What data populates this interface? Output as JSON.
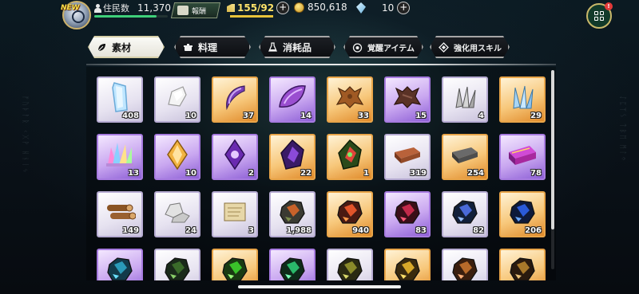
{
  "topbar": {
    "new_badge": "NEW",
    "residents_label": "住民数",
    "residents_value": "11,370",
    "residents_progress": 0.85,
    "report_label": "報酬",
    "stamina_value": "155/92",
    "stamina_progress": 1.0,
    "gold_value": "850,618",
    "crystal_value": "10",
    "menu_badge": "!"
  },
  "tabs": [
    {
      "label": "素材",
      "icon": "leaf-icon",
      "active": true
    },
    {
      "label": "料理",
      "icon": "pot-icon",
      "active": false
    },
    {
      "label": "消耗品",
      "icon": "flask-icon",
      "active": false
    },
    {
      "label": "覚醒アイテム",
      "icon": "awaken-orb-icon",
      "active": false
    },
    {
      "label": "強化用スキル",
      "icon": "skill-diamond-icon",
      "active": false
    }
  ],
  "colors": {
    "rarity_silver": "#e6e2f0",
    "rarity_purple": "#c9a7f0",
    "rarity_gold": "#f7c77a",
    "accent_green": "#3fd07a",
    "accent_yellow": "#ffe36a"
  },
  "items": [
    {
      "name": "crystal-shard-item",
      "rarity": "silver",
      "count": "408",
      "art": "crystal"
    },
    {
      "name": "white-stone-item",
      "rarity": "silver",
      "count": "10",
      "art": "whitestone"
    },
    {
      "name": "purple-claw-item",
      "rarity": "gold",
      "count": "37",
      "art": "claw"
    },
    {
      "name": "purple-scale-item",
      "rarity": "purple",
      "count": "14",
      "art": "scale"
    },
    {
      "name": "brown-hide-item",
      "rarity": "gold",
      "count": "33",
      "art": "hide"
    },
    {
      "name": "dark-hide-item",
      "rarity": "purple",
      "count": "15",
      "art": "darkhide"
    },
    {
      "name": "silver-feathers-item",
      "rarity": "silver",
      "count": "4",
      "art": "feathers"
    },
    {
      "name": "blue-feathers-item",
      "rarity": "gold",
      "count": "29",
      "art": "bluefeathers"
    },
    {
      "name": "rainbow-crystal-item",
      "rarity": "purple",
      "count": "13",
      "art": "rainbow"
    },
    {
      "name": "amber-gem-item",
      "rarity": "purple",
      "count": "10",
      "art": "ambergem"
    },
    {
      "name": "violet-gem-item",
      "rarity": "purple",
      "count": "2",
      "art": "violetgem"
    },
    {
      "name": "dark-core-item",
      "rarity": "gold",
      "count": "22",
      "art": "darkcore"
    },
    {
      "name": "green-core-item",
      "rarity": "gold",
      "count": "1",
      "art": "greencore"
    },
    {
      "name": "brick-item",
      "rarity": "silver",
      "count": "319",
      "art": "brick"
    },
    {
      "name": "iron-ingot-item",
      "rarity": "gold",
      "count": "254",
      "art": "ingot"
    },
    {
      "name": "pink-ingot-item",
      "rarity": "purple",
      "count": "78",
      "art": "pinkingot"
    },
    {
      "name": "logs-item",
      "rarity": "silver",
      "count": "149",
      "art": "logs"
    },
    {
      "name": "stone-blocks-item",
      "rarity": "silver",
      "count": "24",
      "art": "stones"
    },
    {
      "name": "parchment-item",
      "rarity": "silver",
      "count": "3",
      "art": "scroll"
    },
    {
      "name": "ore-rock-item",
      "rarity": "silver",
      "count": "1,988",
      "art": "ore1"
    },
    {
      "name": "red-ore-item",
      "rarity": "gold",
      "count": "940",
      "art": "ore2"
    },
    {
      "name": "crimson-ore-item",
      "rarity": "purple",
      "count": "83",
      "art": "ore3"
    },
    {
      "name": "blue-ore-item",
      "rarity": "silver",
      "count": "82",
      "art": "ore4"
    },
    {
      "name": "sapphire-ore-item",
      "rarity": "gold",
      "count": "206",
      "art": "ore5"
    },
    {
      "name": "blue-teal-ore-item",
      "rarity": "purple",
      "count": "",
      "art": "ore6"
    },
    {
      "name": "green-dark-ore-item",
      "rarity": "silver",
      "count": "",
      "art": "ore7"
    },
    {
      "name": "green-ore-item",
      "rarity": "gold",
      "count": "",
      "art": "ore8"
    },
    {
      "name": "emerald-ore-item",
      "rarity": "purple",
      "count": "",
      "art": "ore9"
    },
    {
      "name": "olive-ore-item",
      "rarity": "silver",
      "count": "",
      "art": "ore10"
    },
    {
      "name": "gold-ore-item",
      "rarity": "gold",
      "count": "",
      "art": "ore11"
    },
    {
      "name": "copper-ore-item",
      "rarity": "silver",
      "count": "",
      "art": "ore12"
    },
    {
      "name": "bronze-ore-item",
      "rarity": "gold",
      "count": "",
      "art": "ore13"
    }
  ],
  "scroll": {
    "position": 0.0,
    "visible_fraction": 0.8
  }
}
